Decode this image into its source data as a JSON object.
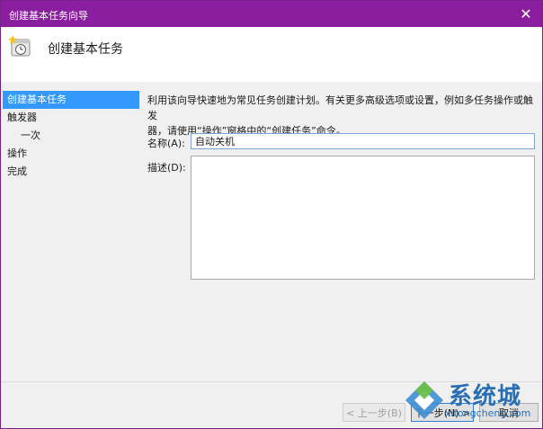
{
  "window": {
    "title": "创建基本任务向导",
    "close_glyph": "✕"
  },
  "header": {
    "title": "创建基本任务",
    "icon": "task-clock-icon"
  },
  "sidebar": {
    "steps": [
      {
        "label": "创建基本任务",
        "active": true
      },
      {
        "label": "触发器"
      },
      {
        "label": "一次",
        "sub": true
      },
      {
        "label": "操作"
      },
      {
        "label": "完成"
      }
    ]
  },
  "content": {
    "description_line1": "利用该向导快速地为常见任务创建计划。有关更多高级选项或设置，例如多任务操作或触发",
    "description_line2": "器，请使用“操作”窗格中的“创建任务”命令。",
    "name_label": "名称(A):",
    "name_value": "自动关机",
    "desc_label": "描述(D):",
    "desc_value": ""
  },
  "buttons": {
    "back": "< 上一步(B)",
    "next": "下一步(N) >",
    "cancel": "取消"
  },
  "watermark": {
    "text": "系统城",
    "subtext": "xitongcheng.com"
  },
  "colors": {
    "titlebar": "#8a1e9e",
    "active_step": "#3399ff",
    "watermark": "#2a6fb3"
  }
}
